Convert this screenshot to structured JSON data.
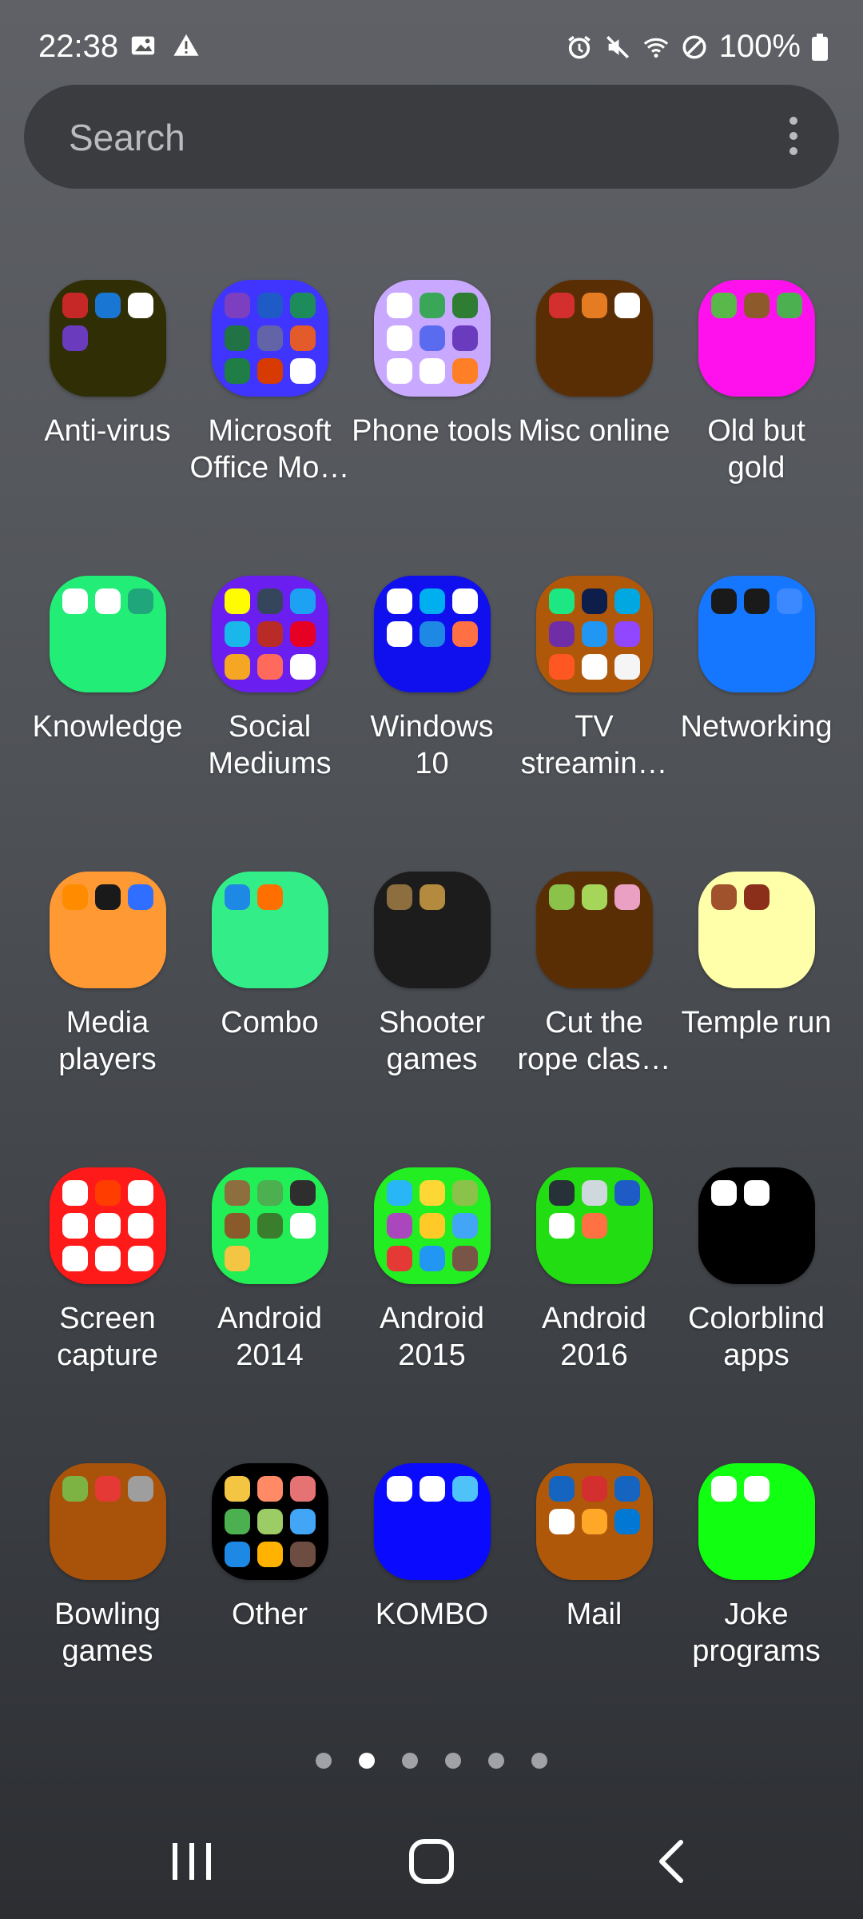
{
  "status": {
    "time": "22:38",
    "battery": "100%",
    "left_icons": [
      "image-icon",
      "alert-icon"
    ],
    "right_icons": [
      "alarm-icon",
      "mute-icon",
      "wifi-icon",
      "blocked-icon",
      "battery-icon"
    ]
  },
  "search": {
    "placeholder": "Search"
  },
  "folders": [
    {
      "label": "Anti-virus",
      "color": "#2f2e04",
      "mini": [
        "#c62828",
        "#1976d2",
        "#ffffff",
        "#6a3bbd"
      ]
    },
    {
      "label": "Microsoft Office Mo…",
      "color": "#3f35ff",
      "mini": [
        "#7b3fbf",
        "#1e5bc6",
        "#1e8c5a",
        "#217346",
        "#6264a7",
        "#e35b2a",
        "#1e7e45",
        "#d83b01",
        "#ffffff"
      ]
    },
    {
      "label": "Phone tools",
      "color": "#c8a9ff",
      "mini": [
        "#ffffff",
        "#3aa657",
        "#2e7d32",
        "#ffffff",
        "#5b6bf0",
        "#6a3bbd",
        "#ffffff",
        "#ffffff",
        "#ff7f27"
      ]
    },
    {
      "label": "Misc online",
      "color": "#5a2e05",
      "mini": [
        "#d32f2f",
        "#e67c22",
        "#ffffff"
      ]
    },
    {
      "label": "Old but gold",
      "color": "#ff11ee",
      "mini": [
        "#5ab84a",
        "#8d5a2b",
        "#4caf50"
      ]
    },
    {
      "label": "Knowledge",
      "color": "#22ee77",
      "mini": [
        "#ffffff",
        "#ffffff",
        "#1fa67a"
      ]
    },
    {
      "label": "Social Mediums",
      "color": "#6a1ff0",
      "mini": [
        "#fffc00",
        "#35465c",
        "#1da1f2",
        "#1ab7ea",
        "#b92b27",
        "#e60023",
        "#f5a623",
        "#ff6a5c",
        "#ffffff"
      ]
    },
    {
      "label": "Windows 10",
      "color": "#1010ee",
      "mini": [
        "#ffffff",
        "#00aff0",
        "#ffffff",
        "#ffffff",
        "#1e88e5",
        "#ff7043"
      ]
    },
    {
      "label": "TV streamin…",
      "color": "#b0580a",
      "mini": [
        "#1ce783",
        "#0e1e4b",
        "#00a8e1",
        "#6f2da8",
        "#2196f3",
        "#9146ff",
        "#ff5722",
        "#ffffff",
        "#f5f5f5"
      ]
    },
    {
      "label": "Networking",
      "color": "#1577ff",
      "mini": [
        "#1a1a1a",
        "#1a1a1a",
        "#3b88ff"
      ]
    },
    {
      "label": "Media players",
      "color": "#ff9933",
      "mini": [
        "#ff8c00",
        "#1a1a1a",
        "#2f6eff"
      ]
    },
    {
      "label": "Combo",
      "color": "#33ee88",
      "mini": [
        "#1e88e5",
        "#ff6f00"
      ]
    },
    {
      "label": "Shooter games",
      "color": "#1c1c1c",
      "mini": [
        "#8d6e3f",
        "#b38a3e"
      ]
    },
    {
      "label": "Cut the rope clas…",
      "color": "#5a2e05",
      "mini": [
        "#8bc34a",
        "#a5d65a",
        "#e9a0c2"
      ]
    },
    {
      "label": "Temple run",
      "color": "#ffffaa",
      "mini": [
        "#a0522d",
        "#8b2e1a"
      ]
    },
    {
      "label": "Screen capture",
      "color": "#ff1a1a",
      "mini": [
        "#ffffff",
        "#ff3d00",
        "#ffffff",
        "#ffffff",
        "#ffffff",
        "#ffffff",
        "#ffffff",
        "#ffffff",
        "#ffffff"
      ]
    },
    {
      "label": "Android 2014",
      "color": "#22ee55",
      "mini": [
        "#8d6e3f",
        "#4caf50",
        "#2e2e2e",
        "#8b5a2b",
        "#3a7d2c",
        "#ffffff",
        "#f4c542"
      ]
    },
    {
      "label": "Android 2015",
      "color": "#22ee22",
      "mini": [
        "#29b6f6",
        "#fdd835",
        "#8bc34a",
        "#ab47bc",
        "#ffca28",
        "#42a5f5",
        "#e53935",
        "#2196f3",
        "#795548"
      ]
    },
    {
      "label": "Android 2016",
      "color": "#22dd11",
      "mini": [
        "#263238",
        "#cfd8dc",
        "#1e5bc6",
        "#ffffff",
        "#ff7043"
      ]
    },
    {
      "label": "Colorblind apps",
      "color": "#000000",
      "mini": [
        "#ffffff",
        "#ffffff"
      ]
    },
    {
      "label": "Bowling games",
      "color": "#a8520a",
      "mini": [
        "#7cb342",
        "#e53935",
        "#9e9e9e"
      ]
    },
    {
      "label": "Other",
      "color": "#000000",
      "mini": [
        "#f4c542",
        "#ff8a65",
        "#e57373",
        "#4caf50",
        "#9ccc65",
        "#42a5f5",
        "#1e88e5",
        "#ffb300",
        "#6d4c41"
      ]
    },
    {
      "label": "KOMBO",
      "color": "#0a0aff",
      "mini": [
        "#ffffff",
        "#ffffff",
        "#4fc3f7"
      ]
    },
    {
      "label": "Mail",
      "color": "#b0580a",
      "mini": [
        "#1565c0",
        "#d32f2f",
        "#1565c0",
        "#ffffff",
        "#ffa726",
        "#0078d4"
      ]
    },
    {
      "label": "Joke programs",
      "color": "#11ff11",
      "mini": [
        "#ffffff",
        "#ffffff"
      ]
    }
  ],
  "page_indicator": {
    "count": 6,
    "active_index": 1
  },
  "nav": {
    "buttons": [
      "recents-icon",
      "home-icon",
      "back-icon"
    ]
  }
}
